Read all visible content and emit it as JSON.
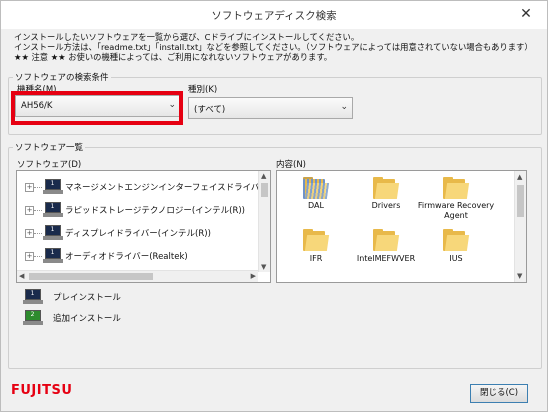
{
  "window": {
    "title": "ソフトウェアディスク検索",
    "close_glyph": "✕"
  },
  "messages": [
    "インストールしたいソフトウェアを一覧から選び、Cドライブにインストールしてください。",
    "インストール方法は、「readme.txt」「install.txt」などを参照してください。（ソフトウェアによっては用意されていない場合もあります）",
    "★★ 注意 ★★ お使いの機種によっては、ご利用になれないソフトウェアがあります。"
  ],
  "search": {
    "group_label": "ソフトウェアの検索条件",
    "model_label": "機種名(M)",
    "model_value": "AH56/K",
    "type_label": "種別(K)",
    "type_value": "(すべて)",
    "highlight_color": "#e60012"
  },
  "list": {
    "group_label": "ソフトウェア一覧",
    "software_label": "ソフトウェア(D)",
    "content_label": "内容(N)",
    "items": [
      {
        "label": "マネージメントエンジンインターフェイスドライバー(",
        "badge": "1"
      },
      {
        "label": "ラピッドストレージテクノロジー(インテル(R))",
        "badge": "1"
      },
      {
        "label": "ディスプレイドライバー(インテル(R))",
        "badge": "1"
      },
      {
        "label": "オーディオドライバー(Realtek)",
        "badge": "1"
      }
    ],
    "folders": [
      {
        "name": "DAL",
        "icon": "folder-striped-icon"
      },
      {
        "name": "Drivers",
        "icon": "folder-icon"
      },
      {
        "name": "Firmware Recovery Agent",
        "icon": "folder-icon"
      },
      {
        "name": "IFR",
        "icon": "folder-icon"
      },
      {
        "name": "IntelMEFWVER",
        "icon": "folder-icon"
      },
      {
        "name": "IUS",
        "icon": "folder-icon"
      }
    ]
  },
  "legend": {
    "preinstall": {
      "label": "プレインストール",
      "badge": "1",
      "color": "#1a2b4c"
    },
    "additional": {
      "label": "追加インストール",
      "badge": "2",
      "color": "#2e8b2e"
    }
  },
  "footer": {
    "logo": "FUJITSU",
    "close_button": "閉じる(C)"
  }
}
